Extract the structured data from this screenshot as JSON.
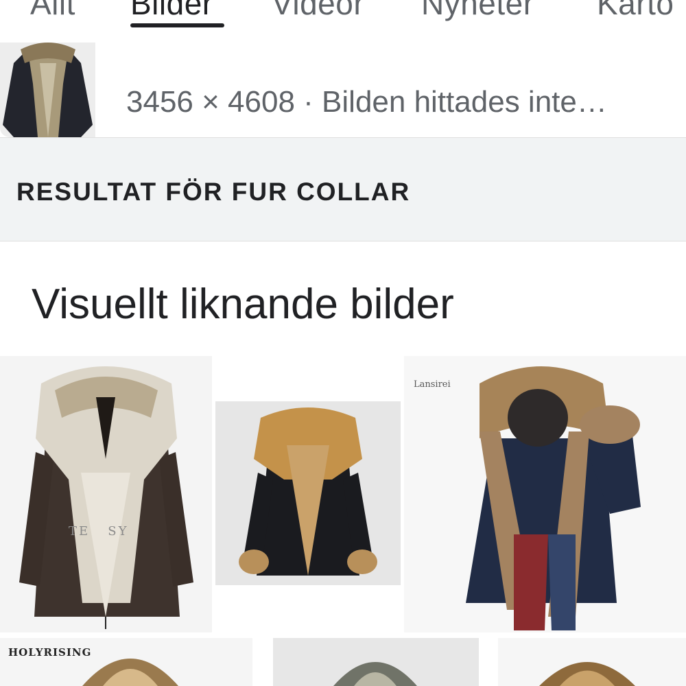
{
  "tabs": [
    {
      "label": "Allt",
      "active": false
    },
    {
      "label": "Bilder",
      "active": true
    },
    {
      "label": "Videor",
      "active": false
    },
    {
      "label": "Nyheter",
      "active": false
    },
    {
      "label": "Karto",
      "active": false
    }
  ],
  "image_info": {
    "dimensions": "3456 × 4608",
    "separator": "·",
    "status": "Bilden hittades inte…"
  },
  "results": {
    "label": "RESULTAT FÖR FUR COLLAR"
  },
  "similar": {
    "title": "Visuellt liknande bilder",
    "tiles": [
      {
        "caption": "",
        "subject": "brown parka with white fur collar"
      },
      {
        "caption": "",
        "subject": "black jacket with tan fox fur trim"
      },
      {
        "caption": "Lansirei",
        "subject": "navy parka with raccoon fur hood"
      },
      {
        "caption": "HOLYRISING",
        "subject": "fur hood parka"
      },
      {
        "caption": "",
        "subject": "grey fur hood"
      },
      {
        "caption": "",
        "subject": "raccoon fur hood"
      }
    ]
  },
  "colors": {
    "text_primary": "#202124",
    "text_secondary": "#5f6368",
    "band_bg": "#f1f3f4"
  }
}
